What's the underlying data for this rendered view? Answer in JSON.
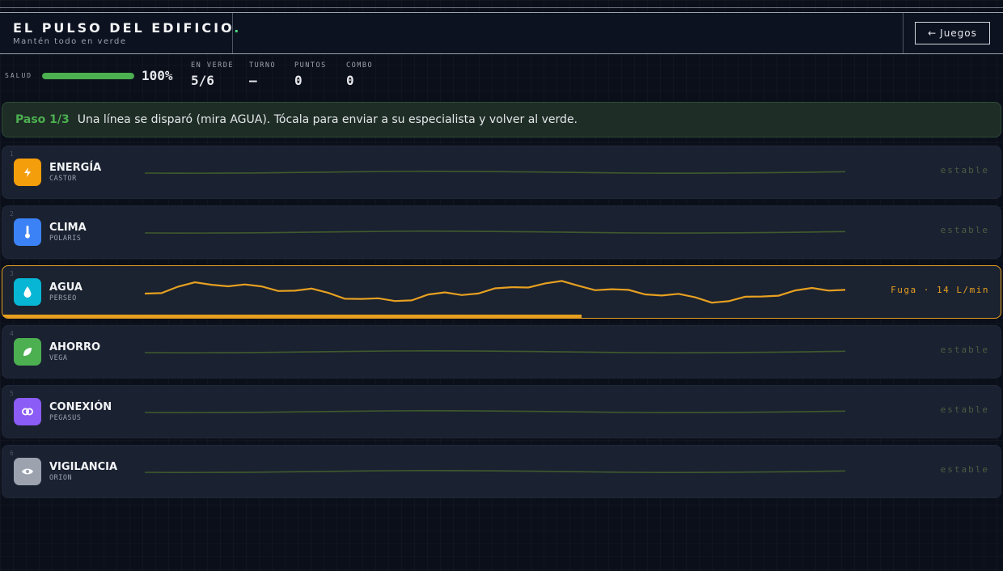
{
  "header": {
    "title": "EL PULSO DEL EDIFICIO",
    "title_dot": ".",
    "subtitle": "Mantén todo en verde",
    "back_label": "Juegos",
    "back_arrow": "←"
  },
  "stats": {
    "health": {
      "label": "SALUD",
      "value": "100%",
      "fraction": 1.0,
      "color": "#4caf50"
    },
    "items": [
      {
        "label": "EN VERDE",
        "value": "5/6"
      },
      {
        "label": "TURNO",
        "value": "—"
      },
      {
        "label": "PUNTOS",
        "value": "0"
      },
      {
        "label": "COMBO",
        "value": "0"
      }
    ]
  },
  "banner": {
    "step": "Paso 1/3",
    "text": "Una línea se disparó (mira AGUA). Tócala para enviar a su especialista y volver al verde."
  },
  "channels": [
    {
      "num": "1",
      "name": "ENERGÍA",
      "owner": "CASTOR",
      "status": "estable",
      "icon": "bolt-icon",
      "color": "#f59e0b",
      "alert": false
    },
    {
      "num": "2",
      "name": "CLIMA",
      "owner": "POLARIS",
      "status": "estable",
      "icon": "thermometer-icon",
      "color": "#3b82f6",
      "alert": false
    },
    {
      "num": "3",
      "name": "AGUA",
      "owner": "PERSEO",
      "status": "Fuga · 14 L/min",
      "icon": "droplet-icon",
      "color": "#06b6d4",
      "alert": true,
      "progress": 0.58
    },
    {
      "num": "4",
      "name": "AHORRO",
      "owner": "VEGA",
      "status": "estable",
      "icon": "leaf-icon",
      "color": "#4caf50",
      "alert": false
    },
    {
      "num": "5",
      "name": "CONEXIÓN",
      "owner": "PEGASUS",
      "status": "estable",
      "icon": "link-icon",
      "color": "#8b5cf6",
      "alert": false
    },
    {
      "num": "6",
      "name": "VIGILANCIA",
      "owner": "ORION",
      "status": "estable",
      "icon": "eye-icon",
      "color": "#9ca3af",
      "alert": false
    }
  ],
  "colors": {
    "stable_line": "#3f5a2e",
    "alert_line": "#e6a020"
  }
}
